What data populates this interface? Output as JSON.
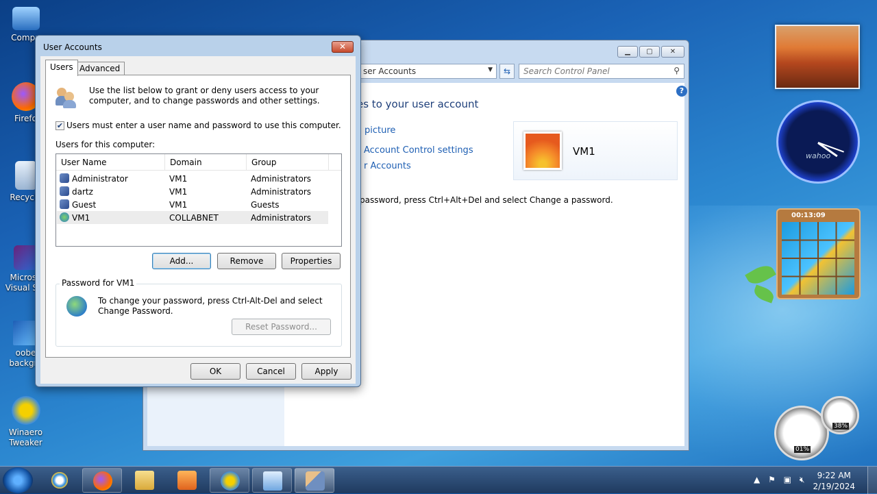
{
  "desktop": {
    "icons": [
      {
        "label": "Compu",
        "icon": "computer-icon"
      },
      {
        "label": "Firefo",
        "icon": "firefox-icon"
      },
      {
        "label": "Recycle",
        "icon": "recycle-bin-icon"
      },
      {
        "label": "Microso",
        "label2": "Visual Stu",
        "icon": "visual-studio-icon"
      },
      {
        "label": "oobe",
        "label2": "backgro",
        "icon": "image-icon"
      },
      {
        "label": "Winaero",
        "label2": "Tweaker",
        "icon": "winaero-tweaker-icon"
      }
    ]
  },
  "gadgets": {
    "clock_brand": "wahoo",
    "puzzle_timer": "00:13:09",
    "meter_cpu": "01%",
    "meter_mem": "38%"
  },
  "control_panel": {
    "address_text": "ser Accounts",
    "search_placeholder": "Search Control Panel",
    "heading": "es to your user account",
    "links": [
      "picture",
      "Account Control settings",
      "r Accounts"
    ],
    "user_name": "VM1",
    "password_text": "password, press Ctrl+Alt+Del and select Change a password."
  },
  "dialog": {
    "title": "User Accounts",
    "close_label": "✕",
    "tabs": [
      "Users",
      "Advanced"
    ],
    "intro": "Use the list below to grant or deny users access to your computer, and to change passwords and other settings.",
    "checkbox_label": "Users must enter a user name and password to use this computer.",
    "checkbox_checked": true,
    "list_label": "Users for this computer:",
    "columns": [
      "User Name",
      "Domain",
      "Group"
    ],
    "rows": [
      {
        "user": "Administrator",
        "domain": "VM1",
        "group": "Administrators"
      },
      {
        "user": "dartz",
        "domain": "VM1",
        "group": "Administrators"
      },
      {
        "user": "Guest",
        "domain": "VM1",
        "group": "Guests"
      },
      {
        "user": "VM1",
        "domain": "COLLABNET",
        "group": "Administrators"
      }
    ],
    "buttons": {
      "add": "Add...",
      "remove": "Remove",
      "properties": "Properties"
    },
    "password_group_label": "Password for VM1",
    "password_text": "To change your password, press Ctrl-Alt-Del and select Change Password.",
    "reset_button": "Reset Password...",
    "ok": "OK",
    "cancel": "Cancel",
    "apply": "Apply"
  },
  "taskbar": {
    "time": "9:22 AM",
    "date": "2/19/2024"
  }
}
